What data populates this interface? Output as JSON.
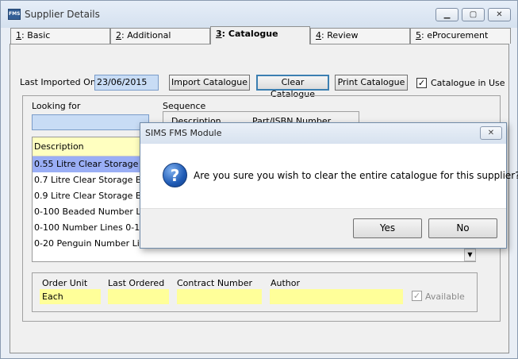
{
  "window": {
    "title": "Supplier Details",
    "app_icon": "FMS"
  },
  "tabs": [
    {
      "key": "1",
      "label": ": Basic"
    },
    {
      "key": "2",
      "label": ": Additional"
    },
    {
      "key": "3",
      "label": ": Catalogue"
    },
    {
      "key": "4",
      "label": ": Review"
    },
    {
      "key": "5",
      "label": ": eProcurement"
    }
  ],
  "catalogue": {
    "last_imported_label": "Last Imported On",
    "last_imported_value": "23/06/2015",
    "import_button": "Import Catalogue",
    "clear_button": "Clear Catalogue",
    "print_button": "Print Catalogue",
    "in_use_label": "Catalogue in Use",
    "in_use_check": "✓",
    "looking_for_label": "Looking for",
    "sequence_label": "Sequence",
    "sequence_options": [
      "Description",
      "Part/ISBN Number"
    ],
    "list_header": "Description",
    "rows": [
      "0.55 Litre Clear Storage Box",
      "0.7 Litre Clear Storage Box",
      "0.9 Litre Clear Storage Box",
      "0-100 Beaded Number Line",
      "0-100 Number Lines 0-100",
      "0-20 Penguin Number Line"
    ],
    "fields": {
      "order_unit_label": "Order Unit",
      "order_unit_value": "Each",
      "last_ordered_label": "Last Ordered",
      "contract_number_label": "Contract Number",
      "author_label": "Author",
      "available_label": "Available",
      "available_check": "✓"
    }
  },
  "dialog": {
    "title": "SIMS FMS Module",
    "icon_glyph": "?",
    "message": "Are you sure you wish to clear the entire catalogue for this supplier?",
    "yes": "Yes",
    "no": "No"
  }
}
